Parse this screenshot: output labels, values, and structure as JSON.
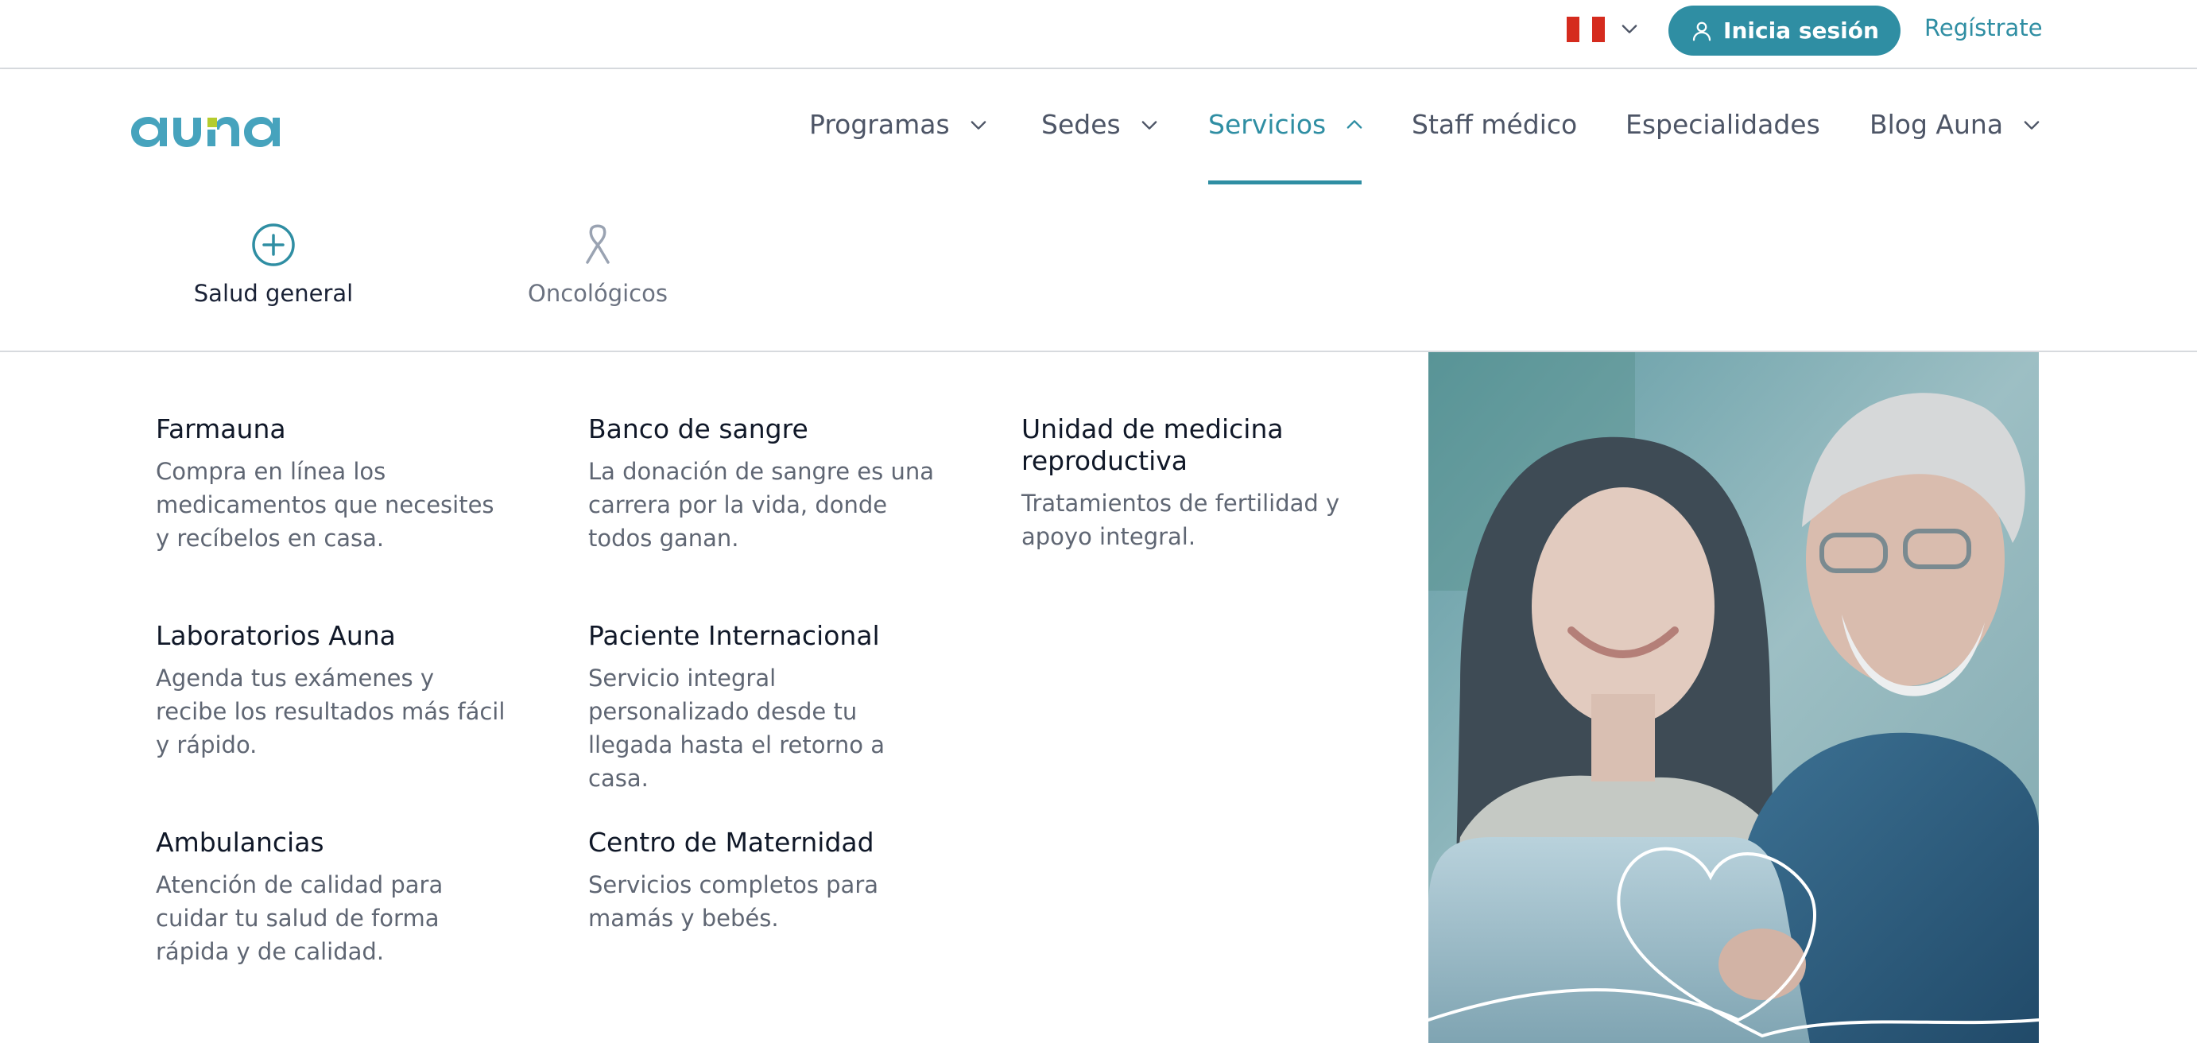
{
  "header": {
    "country_flag": "peru-flag-icon",
    "login_label": "Inicia sesión",
    "register_label": "Regístrate"
  },
  "brand": {
    "logo_text": "auna",
    "accent": "#2f8ea3",
    "logo_color": "#46a3bd",
    "logo_green": "#b5cc2d"
  },
  "nav": {
    "items": [
      {
        "label": "Programas"
      },
      {
        "label": "Sedes"
      },
      {
        "label": "Servicios"
      },
      {
        "label": "Staff médico"
      },
      {
        "label": "Especialidades"
      },
      {
        "label": "Blog Auna"
      }
    ],
    "active": "Servicios"
  },
  "categories": [
    {
      "label": "Salud general",
      "icon": "plus-circle-icon",
      "active": true
    },
    {
      "label": "Oncológicos",
      "icon": "cancer-ribbon-icon",
      "active": false
    }
  ],
  "services": [
    {
      "title": "Farmauna",
      "desc": "Compra en línea los medicamentos que necesites y recíbelos en casa."
    },
    {
      "title": "Banco de sangre",
      "desc": "La donación de sangre es una carrera por la vida, donde todos ganan."
    },
    {
      "title": "Unidad de medicina reproductiva",
      "desc": "Tratamientos de fertilidad y apoyo integral."
    },
    {
      "title": "Laboratorios Auna",
      "desc": "Agenda tus exámenes y recibe los resultados más fácil y rápido."
    },
    {
      "title": "Paciente Internacional",
      "desc": "Servicio integral personalizado desde tu llegada hasta el retorno a casa."
    },
    {
      "title": "Ambulancias",
      "desc": "Atención de calidad para cuidar tu salud de forma rápida y de calidad."
    },
    {
      "title": "Centro de Maternidad",
      "desc": "Servicios completos para mamás y bebés."
    }
  ],
  "promo_image": {
    "subject": "woman and older man smiling at laptop"
  }
}
